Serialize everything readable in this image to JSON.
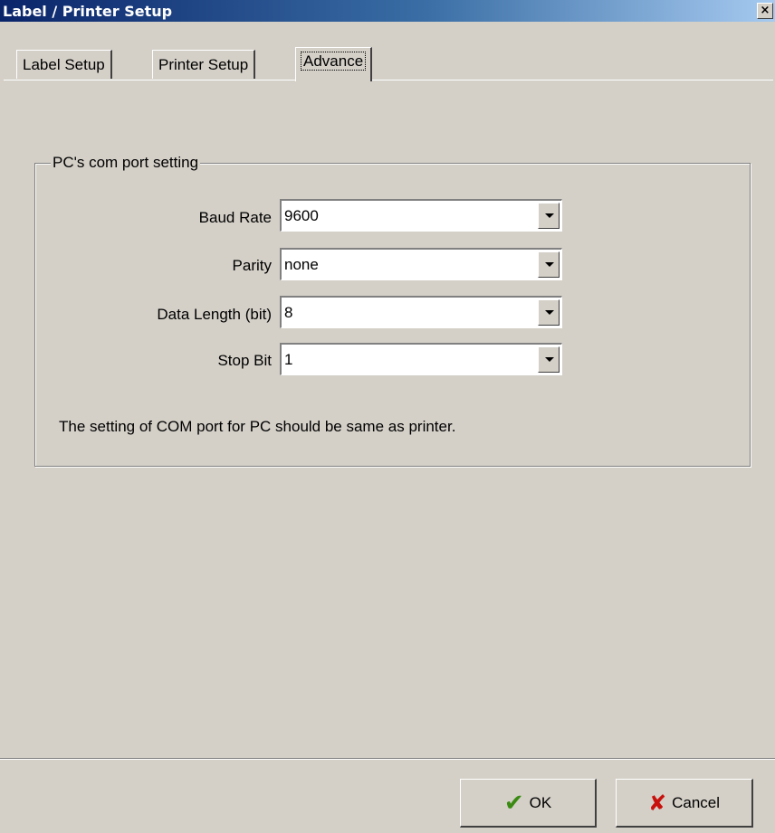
{
  "window": {
    "title": "Label / Printer Setup",
    "close_glyph": "×"
  },
  "tabs": [
    {
      "label": "Label Setup",
      "active": false
    },
    {
      "label": "Printer Setup",
      "active": false
    },
    {
      "label": "Advance",
      "active": true
    }
  ],
  "group": {
    "title": "PC's com port setting",
    "fields": [
      {
        "label": "Baud Rate",
        "value": "9600"
      },
      {
        "label": "Parity",
        "value": "none"
      },
      {
        "label": "Data Length (bit)",
        "value": "8"
      },
      {
        "label": "Stop Bit",
        "value": "1"
      }
    ],
    "note": "The setting of COM port for PC should be same as printer."
  },
  "buttons": {
    "ok": {
      "label": "OK",
      "icon": "checkmark-icon",
      "icon_glyph": "✔",
      "icon_color": "#3a8a12"
    },
    "cancel": {
      "label": "Cancel",
      "icon": "x-icon",
      "icon_glyph": "✘",
      "icon_color": "#c8100c"
    }
  },
  "colors": {
    "title_start": "#0a246a",
    "title_end": "#a6caf0",
    "face": "#d4d0c8"
  }
}
